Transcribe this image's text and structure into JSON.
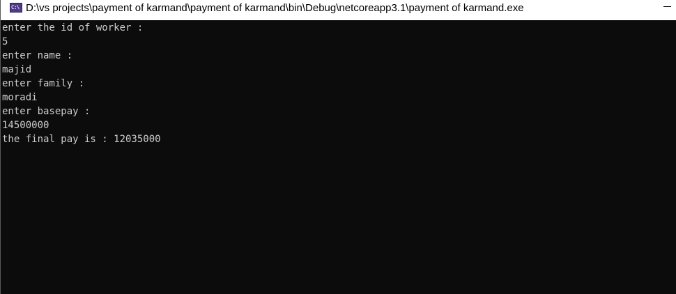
{
  "window": {
    "title": "D:\\vs projects\\payment of karmand\\payment of karmand\\bin\\Debug\\netcoreapp3.1\\payment of karmand.exe",
    "icon": "console-app-icon",
    "icon_glyph": "C:\\"
  },
  "console": {
    "lines": [
      "enter the id of worker :",
      "5",
      "enter name :",
      "majid",
      "enter family :",
      "moradi",
      "enter basepay :",
      "14500000",
      "the final pay is : 12035000"
    ],
    "text_color": "#cccccc",
    "background_color": "#0c0c0c"
  }
}
